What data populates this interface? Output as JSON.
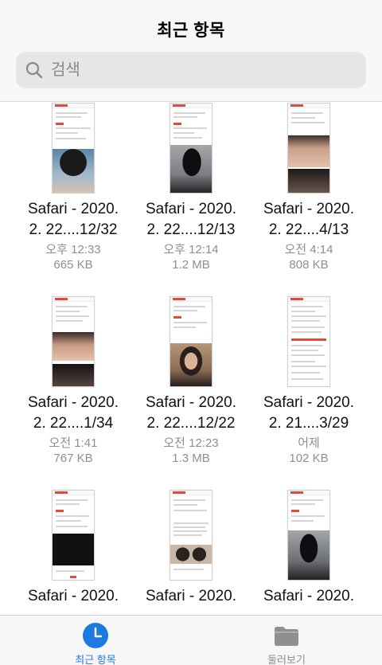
{
  "header": {
    "title": "최근 항목"
  },
  "search": {
    "placeholder": "검색"
  },
  "files": [
    {
      "name_line1": "Safari - 2020.",
      "name_line2": "2. 22....12/32",
      "time": "오후 12:33",
      "size": "665 KB"
    },
    {
      "name_line1": "Safari - 2020.",
      "name_line2": "2. 22....12/13",
      "time": "오후 12:14",
      "size": "1.2 MB"
    },
    {
      "name_line1": "Safari - 2020.",
      "name_line2": "2. 22....4/13",
      "time": "오전 4:14",
      "size": "808 KB"
    },
    {
      "name_line1": "Safari - 2020.",
      "name_line2": "2. 22....1/34",
      "time": "오전 1:41",
      "size": "767 KB"
    },
    {
      "name_line1": "Safari - 2020.",
      "name_line2": "2. 22....12/22",
      "time": "오전 12:23",
      "size": "1.3 MB"
    },
    {
      "name_line1": "Safari - 2020.",
      "name_line2": "2. 21....3/29",
      "time": "어제",
      "size": "102 KB"
    },
    {
      "name_line1": "Safari - 2020."
    },
    {
      "name_line1": "Safari - 2020."
    },
    {
      "name_line1": "Safari - 2020."
    }
  ],
  "tabs": [
    {
      "label": "최근 항목",
      "icon": "clock-icon",
      "active": true
    },
    {
      "label": "둘러보기",
      "icon": "folder-icon",
      "active": false
    }
  ],
  "colors": {
    "accent": "#1f7ae0",
    "muted": "#8e8e93",
    "tab_inactive": "#8e8e93"
  }
}
